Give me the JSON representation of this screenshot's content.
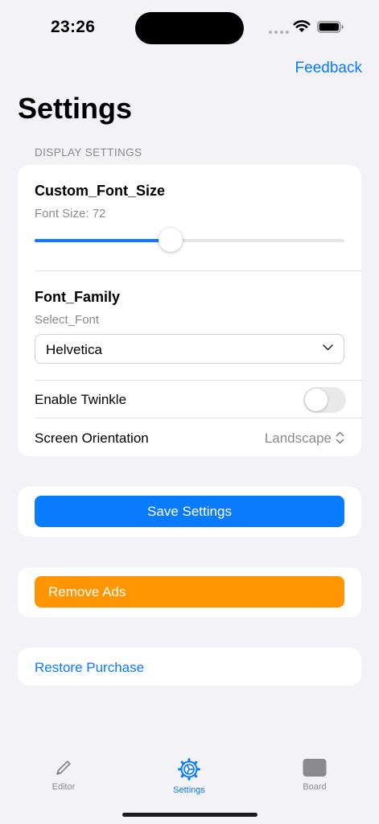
{
  "status": {
    "time": "23:26"
  },
  "header": {
    "feedback_label": "Feedback",
    "title": "Settings"
  },
  "display_settings": {
    "section_label": "DISPLAY SETTINGS",
    "font_size": {
      "title": "Custom_Font_Size",
      "value_label": "Font Size: 72",
      "slider_fraction": 0.44
    },
    "font_family": {
      "title": "Font_Family",
      "placeholder": "Select_Font",
      "selected": "Helvetica"
    },
    "twinkle": {
      "label": "Enable Twinkle",
      "enabled": false
    },
    "orientation": {
      "label": "Screen Orientation",
      "value": "Landscape"
    }
  },
  "actions": {
    "save_label": "Save Settings",
    "remove_ads_label": "Remove Ads",
    "restore_label": "Restore Purchase"
  },
  "tabs": [
    {
      "label": "Editor",
      "icon": "pencil-icon",
      "active": false
    },
    {
      "label": "Settings",
      "icon": "gear-icon",
      "active": true
    },
    {
      "label": "Board",
      "icon": "board-icon",
      "active": false
    }
  ],
  "colors": {
    "accent": "#0a7bff",
    "orange": "#ff9500",
    "background": "#f2f2f7"
  }
}
